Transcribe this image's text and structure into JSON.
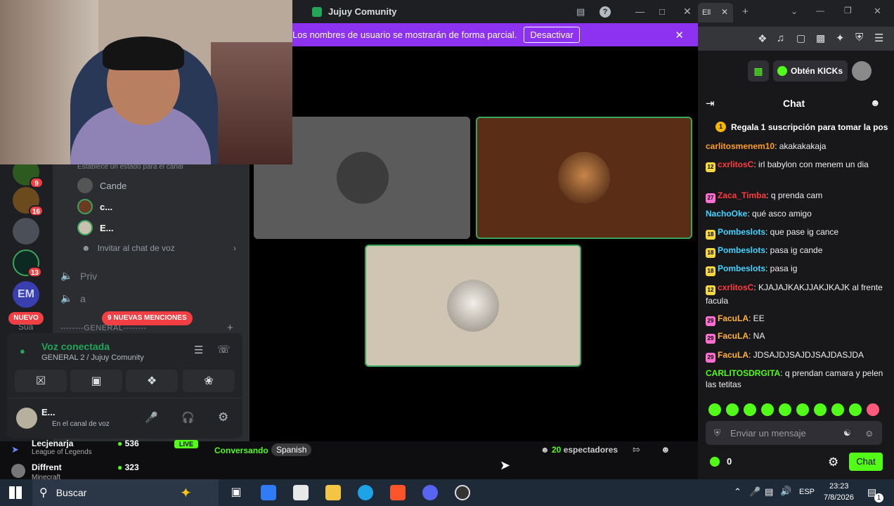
{
  "call_window": {
    "title": "Jujuy Comunity",
    "banner_text": "Los nombres de usuario se mostrarán de forma parcial.",
    "banner_button": "Desactivar"
  },
  "discord": {
    "server_badges": [
      "9",
      "16",
      "13"
    ],
    "status_hint": "Establece un estado para el canal",
    "voice_users": [
      "Cande",
      "c...",
      "E..."
    ],
    "invite_label": "Invitar al chat de voz",
    "channels": [
      "Priv",
      "a"
    ],
    "new_label": "NUEVO",
    "new_mentions": "9 NUEVAS MENCIONES",
    "category": "--------GENERAL--------",
    "category_prefix": "Sua",
    "voice": {
      "status": "Voz conectada",
      "location": "GENERAL 2 / Jujuy Comunity"
    },
    "user": {
      "name": "E...",
      "status": "En el canal de voz"
    }
  },
  "browser": {
    "tab_title": "Ell"
  },
  "kick": {
    "get_kicks": "Obtén KICKs",
    "chat_title": "Chat",
    "pinned": "Regala 1 suscripción para tomar la pos",
    "messages": [
      {
        "user": "carlitosmenem10",
        "text": ": akakakakaja",
        "color": "#ff9f1c",
        "badge": ""
      },
      {
        "user": "cxrlitosC",
        "text": ": irl babylon con menem un dia",
        "color": "#ff3b3b",
        "badge": "12"
      },
      {
        "user": "Zaca_Timba",
        "text": ": q prenda cam",
        "color": "#ff3b3b",
        "badge": "27"
      },
      {
        "user": "NachoOke",
        "text": ": qué asco amigo",
        "color": "#3fd4ff",
        "badge": ""
      },
      {
        "user": "Pombeslots",
        "text": ": que pase ig cance",
        "color": "#3fd4ff",
        "badge": "18"
      },
      {
        "user": "Pombeslots",
        "text": ": pasa ig cande",
        "color": "#3fd4ff",
        "badge": "18"
      },
      {
        "user": "Pombeslots",
        "text": ": pasa ig",
        "color": "#3fd4ff",
        "badge": "18"
      },
      {
        "user": "cxrlitosC",
        "text": ": KJAJAJKAKJJAKJKAJK al frente facula",
        "color": "#ff3b3b",
        "badge": "12"
      },
      {
        "user": "FacuLA",
        "text": ": EE",
        "color": "#ffb23f",
        "badge": "29"
      },
      {
        "user": "FacuLA",
        "text": ": NA",
        "color": "#ffb23f",
        "badge": "29"
      },
      {
        "user": "FacuLA",
        "text": ": JDSAJDJSAJDJSAJDASJDA",
        "color": "#ffb23f",
        "badge": "29"
      },
      {
        "user": "CARLITOSDRGITA",
        "text": ": q prendan camara y pelen las tetitas",
        "color": "#53fc18",
        "badge": ""
      }
    ],
    "input_placeholder": "Enviar un mensaje",
    "kicks_count": "0",
    "chat_button": "Chat"
  },
  "stream": {
    "live_label": "LIVE",
    "category": "Conversando",
    "language": "Spanish",
    "viewers_count": "20",
    "viewers_label": "espectadores",
    "recommended": [
      {
        "name": "Lecjenarja",
        "game": "League of Legends",
        "viewers": "536"
      },
      {
        "name": "Diffrent",
        "game": "Minecraft",
        "viewers": "323"
      }
    ]
  },
  "taskbar": {
    "search_placeholder": "Buscar",
    "lang": "ESP",
    "time": "23:23",
    "date": "7/8/2026",
    "notif_count": "1"
  }
}
